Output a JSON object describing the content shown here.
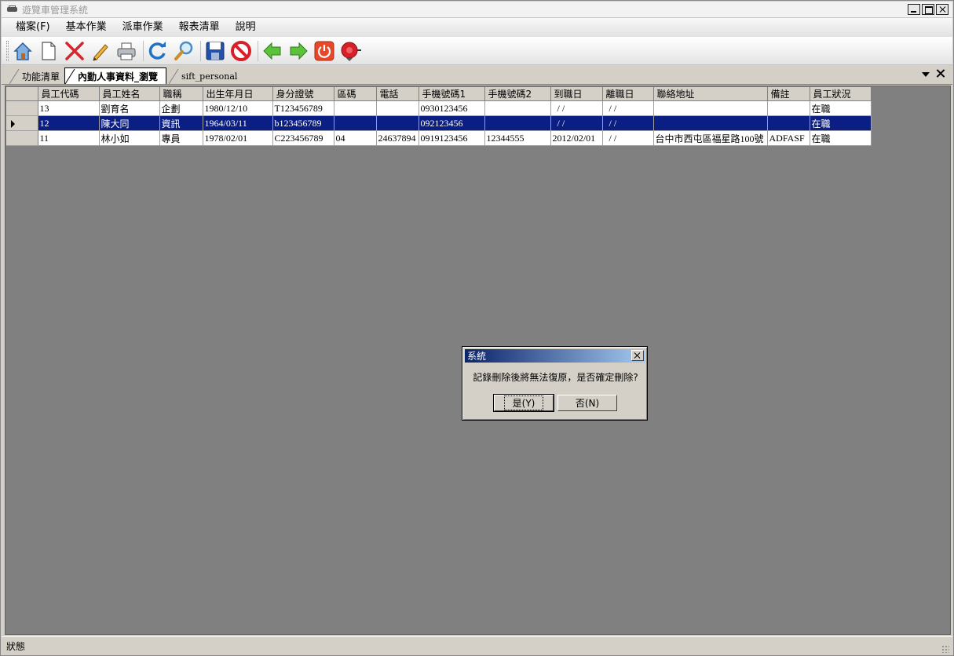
{
  "window": {
    "title": "遊覽車管理系統"
  },
  "menu": {
    "items": [
      "檔案(F)",
      "基本作業",
      "派車作業",
      "報表清單",
      "說明"
    ]
  },
  "toolbar": {
    "buttons": [
      {
        "icon": "home-icon"
      },
      {
        "icon": "new-document-icon"
      },
      {
        "icon": "delete-icon"
      },
      {
        "icon": "edit-pencil-icon"
      },
      {
        "icon": "print-icon"
      },
      {
        "icon": "refresh-icon"
      },
      {
        "icon": "search-icon"
      },
      {
        "icon": "save-icon"
      },
      {
        "icon": "cancel-icon"
      },
      {
        "icon": "previous-arrow-icon"
      },
      {
        "icon": "next-arrow-icon"
      },
      {
        "icon": "power-icon"
      },
      {
        "icon": "alarm-bell-icon"
      }
    ]
  },
  "tabs": [
    {
      "label": "功能清單",
      "active": false
    },
    {
      "label": "內勤人事資料_瀏覽",
      "active": true
    },
    {
      "label": "sift_personal",
      "active": false
    }
  ],
  "grid": {
    "columns": [
      "員工代碼",
      "員工姓名",
      "職稱",
      "出生年月日",
      "身分證號",
      "區碼",
      "電話",
      "手機號碼1",
      "手機號碼2",
      "到職日",
      "離職日",
      "聯絡地址",
      "備註",
      "員工狀況"
    ],
    "rows": [
      [
        "13",
        "劉育名",
        "企劃",
        "1980/12/10",
        "T123456789",
        "",
        "",
        "0930123456",
        "",
        "  / /",
        "  / /",
        "",
        "",
        "在職"
      ],
      [
        "12",
        "陳大同",
        "資訊",
        "1964/03/11",
        "b123456789",
        "",
        "",
        "092123456",
        "",
        "  / /",
        "  / /",
        "",
        "",
        "在職"
      ],
      [
        "11",
        "林小如",
        "專員",
        "1978/02/01",
        "C223456789",
        "04",
        "24637894",
        "0919123456",
        "12344555",
        "2012/02/01",
        "  / /",
        "台中市西屯區福星路100號",
        "ADFASF",
        "在職"
      ]
    ],
    "selected_row": 1
  },
  "dialog": {
    "title": "系統",
    "message": "記錄刪除後將無法復原，是否確定刪除?",
    "yes_label": "是(Y)",
    "no_label": "否(N)"
  },
  "status": {
    "text": "狀態"
  }
}
